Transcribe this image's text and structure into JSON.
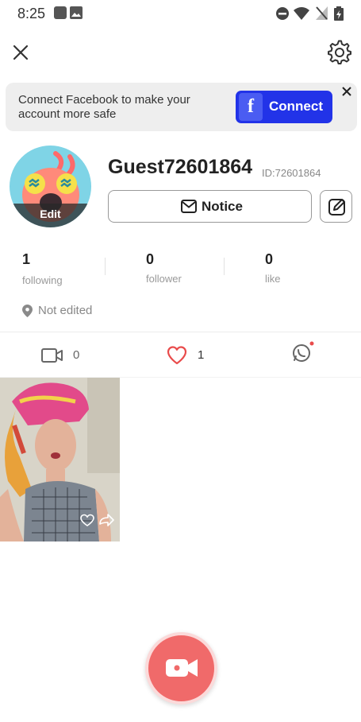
{
  "status_bar": {
    "time": "8:25"
  },
  "facebook_banner": {
    "message": "Connect Facebook to make your account more safe",
    "button_label": "Connect",
    "button_glyph": "f",
    "accent_color": "#2233e8"
  },
  "profile": {
    "avatar_edit_label": "Edit",
    "username": "Guest72601864",
    "user_id": "ID:72601864",
    "notice_label": "Notice"
  },
  "stats": [
    {
      "value": "1",
      "label": "following"
    },
    {
      "value": "0",
      "label": "follower"
    },
    {
      "value": "0",
      "label": "like"
    }
  ],
  "location": "Not edited",
  "tabs": [
    {
      "icon": "video-icon",
      "count": "0"
    },
    {
      "icon": "heart-icon",
      "count": "1"
    },
    {
      "icon": "whatsapp-icon",
      "count": ""
    }
  ],
  "colors": {
    "record_button": "#f06a6a",
    "heart_active": "#e94b4b"
  }
}
